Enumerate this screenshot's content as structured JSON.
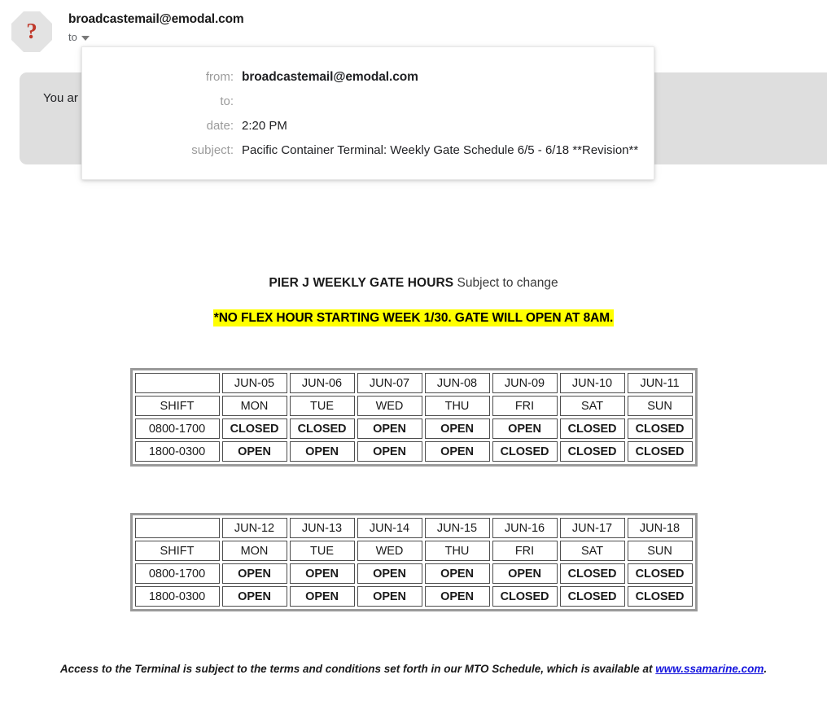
{
  "mail_header": {
    "avatar_glyph": "?",
    "sender_email": "broadcastemail@emodal.com",
    "to_label": "to"
  },
  "notice_banner": {
    "text": "You ar                                                                                                                 messages."
  },
  "details_popup": {
    "rows": [
      {
        "key": "from:",
        "value": "broadcastemail@emodal.com",
        "bold": true
      },
      {
        "key": "to:",
        "value": "",
        "bold": false
      },
      {
        "key": "date:",
        "value": "2:20 PM",
        "bold": false
      },
      {
        "key": "subject:",
        "value": "Pacific Container Terminal: Weekly Gate Schedule 6/5 - 6/18 **Revision**",
        "bold": false
      }
    ],
    "labels": {
      "from": "from:",
      "to": "to:",
      "date": "date:",
      "subject": "subject:"
    },
    "values": {
      "from": "broadcastemail@emodal.com",
      "to": "",
      "date": "2:20 PM",
      "subject": "Pacific Container Terminal: Weekly Gate Schedule 6/5 - 6/18 **Revision**"
    }
  },
  "body": {
    "title_strong": "PIER J WEEKLY GATE HOURS",
    "title_soft": " Subject to change",
    "highlight": "*NO FLEX HOUR STARTING WEEK 1/30.  GATE WILL OPEN AT 8AM.",
    "footer_text_before": "Access to the Terminal is subject to the terms and conditions set forth in our MTO Schedule, which is available at ",
    "footer_link": "www.ssamarine.com",
    "footer_text_after": "."
  },
  "schedule": {
    "shift_header": "SHIFT",
    "shift_rows": [
      "0800-1700",
      "1800-0300"
    ],
    "weekdays": [
      "MON",
      "TUE",
      "WED",
      "THU",
      "FRI",
      "SAT",
      "SUN"
    ],
    "week1": {
      "dates": [
        "JUN-05",
        "JUN-06",
        "JUN-07",
        "JUN-08",
        "JUN-09",
        "JUN-10",
        "JUN-11"
      ],
      "day_shift": [
        "CLOSED",
        "CLOSED",
        "OPEN",
        "OPEN",
        "OPEN",
        "CLOSED",
        "CLOSED"
      ],
      "night_shift": [
        "OPEN",
        "OPEN",
        "OPEN",
        "OPEN",
        "CLOSED",
        "CLOSED",
        "CLOSED"
      ]
    },
    "week2": {
      "dates": [
        "JUN-12",
        "JUN-13",
        "JUN-14",
        "JUN-15",
        "JUN-16",
        "JUN-17",
        "JUN-18"
      ],
      "day_shift": [
        "OPEN",
        "OPEN",
        "OPEN",
        "OPEN",
        "OPEN",
        "CLOSED",
        "CLOSED"
      ],
      "night_shift": [
        "OPEN",
        "OPEN",
        "OPEN",
        "OPEN",
        "CLOSED",
        "CLOSED",
        "CLOSED"
      ]
    }
  },
  "colors": {
    "date_header_bg": "#ccf5e2",
    "open": "#1a8f4c",
    "closed": "#f40000",
    "highlight_bg": "#ffff00",
    "banner_bg": "#dedede",
    "link": "#1414dd",
    "avatar_bg": "#e3e3e3",
    "avatar_glyph": "#c0392b"
  }
}
